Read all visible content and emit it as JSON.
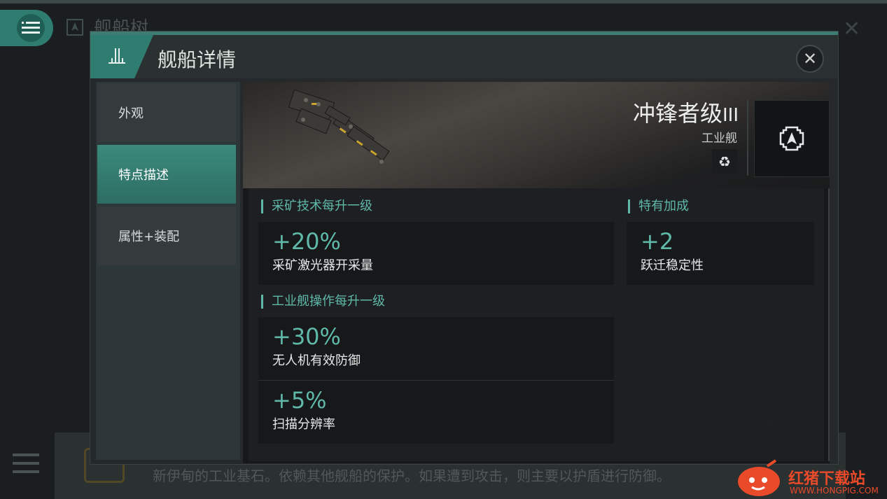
{
  "background": {
    "title": "舰船树",
    "bottom_text": "新伊甸的工业基石。依赖其他舰船的保护。如果遭到攻击，则主要以护盾进行防御。"
  },
  "modal": {
    "title": "舰船详情",
    "close_icon": "close-icon"
  },
  "sidebar": {
    "items": [
      {
        "label": "外观",
        "active": false
      },
      {
        "label": "特点描述",
        "active": true
      },
      {
        "label": "属性+装配",
        "active": false
      }
    ]
  },
  "ship": {
    "name": "冲锋者级",
    "tier": "III",
    "class": "工业舰",
    "recycle_icon": "recycle-icon",
    "class_icon": "industrial-class-icon"
  },
  "sections": {
    "mining": {
      "title": "采矿技术每升一级",
      "stats": [
        {
          "value": "+20%",
          "label": "采矿激光器开采量"
        }
      ]
    },
    "unique": {
      "title": "特有加成",
      "stats": [
        {
          "value": "+2",
          "label": "跃迁稳定性"
        }
      ]
    },
    "industrial": {
      "title": "工业舰操作每升一级",
      "stats": [
        {
          "value": "+30%",
          "label": "无人机有效防御"
        },
        {
          "value": "+5%",
          "label": "扫描分辨率"
        }
      ]
    }
  },
  "watermark": {
    "text": "红猪下载站",
    "url": "WWW.HONGPIG.COM"
  },
  "colors": {
    "accent": "#2f7d70",
    "accent_text": "#5fb8a8",
    "watermark": "#e94a2a"
  }
}
